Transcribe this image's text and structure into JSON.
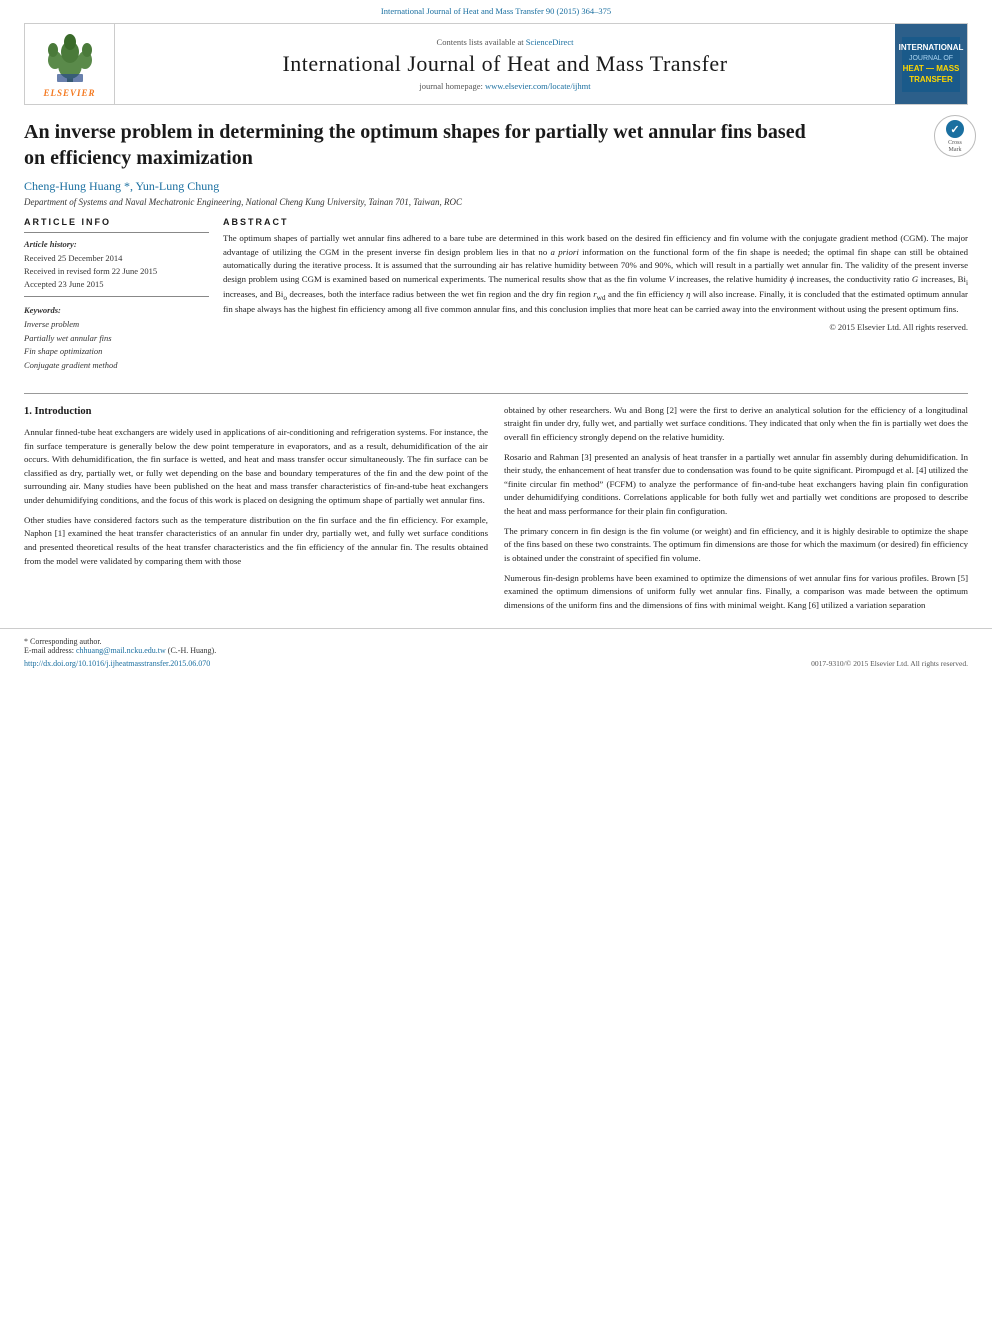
{
  "top_bar": {
    "doi_text": "International Journal of Heat and Mass Transfer 90 (2015) 364–375"
  },
  "journal_header": {
    "contents_text": "Contents lists available at",
    "science_direct": "ScienceDirect",
    "title": "International Journal of Heat and Mass Transfer",
    "homepage_label": "journal homepage:",
    "homepage_url": "www.elsevier.com/locate/ijhmt",
    "elsevier_label": "ELSEVIER",
    "right_title": "HEAT — MASS",
    "right_subtitle": "TRANSFER"
  },
  "article": {
    "title": "An inverse problem in determining the optimum shapes for partially wet annular fins based on efficiency maximization",
    "authors": "Cheng-Hung Huang *, Yun-Lung Chung",
    "affiliation": "Department of Systems and Naval Mechatronic Engineering, National Cheng Kung University, Tainan 701, Taiwan, ROC"
  },
  "article_info": {
    "heading": "Article Info",
    "history_label": "Article history:",
    "received1": "Received 25 December 2014",
    "received2": "Received in revised form 22 June 2015",
    "accepted": "Accepted 23 June 2015",
    "keywords_label": "Keywords:",
    "keywords": [
      "Inverse problem",
      "Partially wet annular fins",
      "Fin shape optimization",
      "Conjugate gradient method"
    ]
  },
  "abstract": {
    "heading": "Abstract",
    "text": "The optimum shapes of partially wet annular fins adhered to a bare tube are determined in this work based on the desired fin efficiency and fin volume with the conjugate gradient method (CGM). The major advantage of utilizing the CGM in the present inverse fin design problem lies in that no a priori information on the functional form of the fin shape is needed; the optimal fin shape can still be obtained automatically during the iterative process. It is assumed that the surrounding air has relative humidity between 70% and 90%, which will result in a partially wet annular fin. The validity of the present inverse design problem using CGM is examined based on numerical experiments. The numerical results show that as the fin volume V increases, the relative humidity ϕ increases, the conductivity ratio G increases, Bi₁ increases, and Bi₀ decreases, both the interface radius between the wet fin region and the dry fin region r_wd and the fin efficiency η will also increase. Finally, it is concluded that the estimated optimum annular fin shape always has the highest fin efficiency among all five common annular fins, and this conclusion implies that more heat can be carried away into the environment without using the present optimum fins.",
    "copyright": "© 2015 Elsevier Ltd. All rights reserved."
  },
  "introduction": {
    "heading": "1. Introduction",
    "paragraphs": [
      "Annular finned-tube heat exchangers are widely used in applications of air-conditioning and refrigeration systems. For instance, the fin surface temperature is generally below the dew point temperature in evaporators, and as a result, dehumidification of the air occurs. With dehumidification, the fin surface is wetted, and heat and mass transfer occur simultaneously. The fin surface can be classified as dry, partially wet, or fully wet depending on the base and boundary temperatures of the fin and the dew point of the surrounding air. Many studies have been published on the heat and mass transfer characteristics of fin-and-tube heat exchangers under dehumidifying conditions, and the focus of this work is placed on designing the optimum shape of partially wet annular fins.",
      "Other studies have considered factors such as the temperature distribution on the fin surface and the fin efficiency. For example, Naphon [1] examined the heat transfer characteristics of an annular fin under dry, partially wet, and fully wet surface conditions and presented theoretical results of the heat transfer characteristics and the fin efficiency of the annular fin. The results obtained from the model were validated by comparing them with those"
    ],
    "paragraphs_right": [
      "obtained by other researchers. Wu and Bong [2] were the first to derive an analytical solution for the efficiency of a longitudinal straight fin under dry, fully wet, and partially wet surface conditions. They indicated that only when the fin is partially wet does the overall fin efficiency strongly depend on the relative humidity.",
      "Rosario and Rahman [3] presented an analysis of heat transfer in a partially wet annular fin assembly during dehumidification. In their study, the enhancement of heat transfer due to condensation was found to be quite significant. Pirompugd et al. [4] utilized the \"finite circular fin method\" (FCFM) to analyze the performance of fin-and-tube heat exchangers having plain fin configuration under dehumidifying conditions. Correlations applicable for both fully wet and partially wet conditions are proposed to describe the heat and mass performance for their plain fin configuration.",
      "The primary concern in fin design is the fin volume (or weight) and fin efficiency, and it is highly desirable to optimize the shape of the fins based on these two constraints. The optimum fin dimensions are those for which the maximum (or desired) fin efficiency is obtained under the constraint of specified fin volume.",
      "Numerous fin-design problems have been examined to optimize the dimensions of wet annular fins for various profiles. Brown [5] examined the optimum dimensions of uniform fully wet annular fins. Finally, a comparison was made between the optimum dimensions of the uniform fins and the dimensions of fins with minimal weight. Kang [6] utilized a variation separation"
    ]
  },
  "footnotes": {
    "corresponding": "* Corresponding author.",
    "email_label": "E-mail address:",
    "email": "chhuang@mail.ncku.edu.tw",
    "email_suffix": "(C.-H. Huang).",
    "doi": "http://dx.doi.org/10.1016/j.ijheatmasstransfer.2015.06.070",
    "issn": "0017-9310/© 2015 Elsevier Ltd. All rights reserved."
  }
}
